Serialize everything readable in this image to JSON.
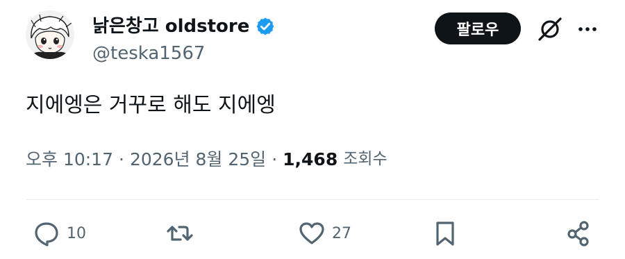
{
  "author": {
    "display_name": "낡은창고 oldstore",
    "handle": "@teska1567",
    "verified": true,
    "avatar_icon": "anime-avatar-icon"
  },
  "header": {
    "follow_label": "팔로우",
    "grok_icon": "grok-icon",
    "more_icon": "more-icon"
  },
  "tweet": {
    "text": "지에엥은 거꾸로 해도 지에엥"
  },
  "meta": {
    "time": "오후 10:17",
    "separator": "·",
    "date": "2026년 8월 25일",
    "views_count": "1,468",
    "views_label": "조회수"
  },
  "actions": {
    "reply_count": "10",
    "retweet_count": "",
    "like_count": "27"
  },
  "colors": {
    "verified_blue": "#1d9bf0",
    "secondary_text": "#536471",
    "primary_text": "#0f1419",
    "follow_bg": "#0f1419"
  }
}
